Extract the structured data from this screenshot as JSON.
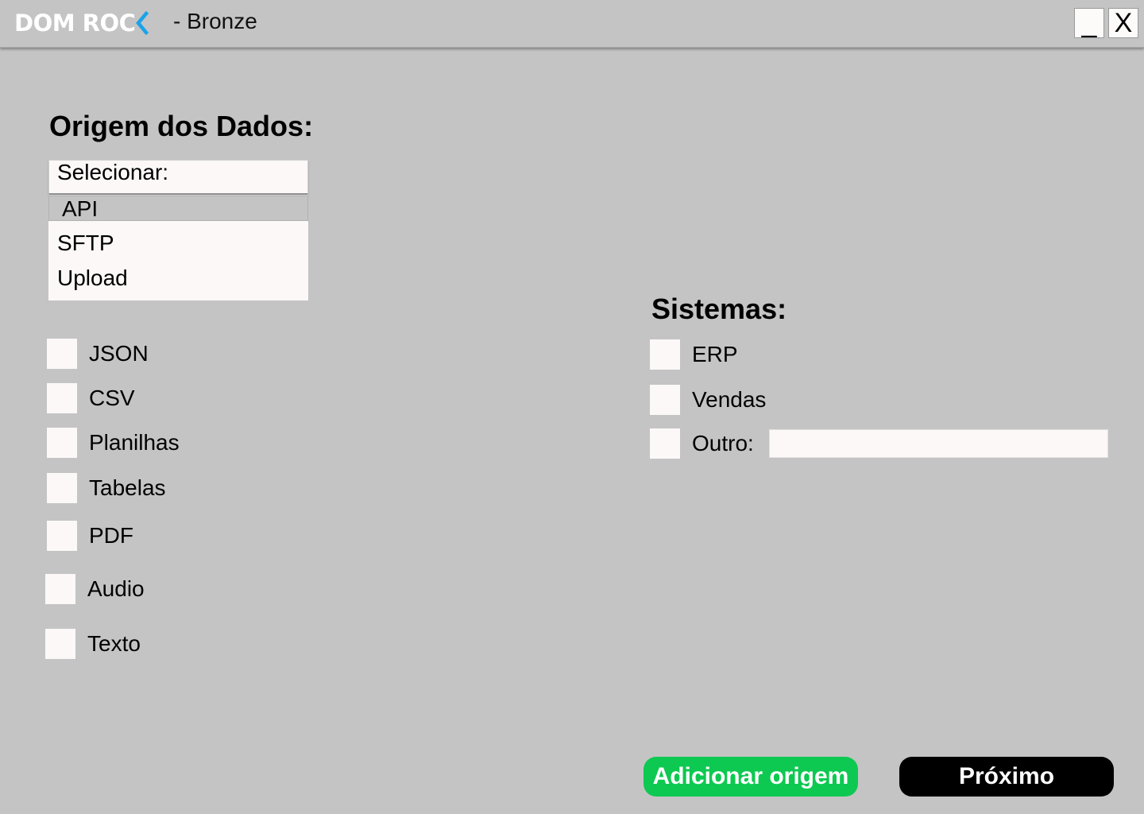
{
  "window": {
    "brand": "DOM ROC",
    "title": "- Bronze",
    "minimize_label": "_",
    "close_label": "X",
    "brand_accent_color": "#1aa3e8"
  },
  "origem": {
    "title": "Origem dos Dados:",
    "select": {
      "placeholder": "Selecionar:",
      "options": [
        "API",
        "SFTP",
        "Upload"
      ],
      "highlighted": "API"
    },
    "formats": [
      "JSON",
      "CSV",
      "Planilhas",
      "Tabelas",
      "PDF",
      "Audio",
      "Texto"
    ]
  },
  "sistemas": {
    "title": "Sistemas:",
    "options": [
      "ERP",
      "Vendas",
      "Outro:"
    ],
    "outro_value": ""
  },
  "actions": {
    "add_label": "Adicionar origem",
    "next_label": "Próximo",
    "add_color": "#0dc951",
    "next_color": "#000000"
  }
}
